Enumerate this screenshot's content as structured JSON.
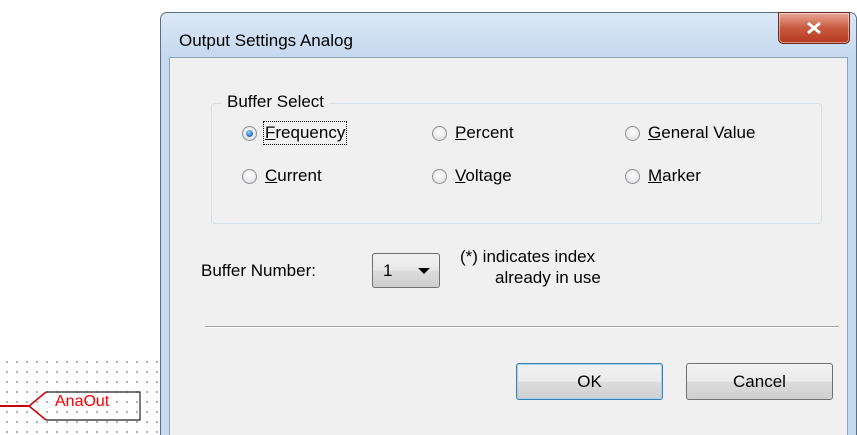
{
  "background_canvas": {
    "component_label": "AnaOut",
    "accent_color": "#ff0000"
  },
  "dialog": {
    "title": "Output Settings Analog",
    "close_icon": "close-x-icon",
    "buffer_select": {
      "legend": "Buffer Select",
      "options": [
        {
          "label": "Frequency",
          "mnemonic": "F",
          "rest": "requency",
          "checked": true
        },
        {
          "label": "Percent",
          "mnemonic": "P",
          "rest": "ercent",
          "checked": false
        },
        {
          "label": "General Value",
          "mnemonic": "G",
          "rest": "eneral Value",
          "checked": false
        },
        {
          "label": "Current",
          "mnemonic": "C",
          "rest": "urrent",
          "checked": false
        },
        {
          "label": "Voltage",
          "mnemonic": "V",
          "rest": "oltage",
          "checked": false
        },
        {
          "label": "Marker",
          "mnemonic": "M",
          "rest": "arker",
          "checked": false
        }
      ]
    },
    "buffer_number": {
      "label": "Buffer Number:",
      "value": "1"
    },
    "hint": {
      "line1": "(*) indicates index",
      "line2": "already in use"
    },
    "ok_label": "OK",
    "cancel_label": "Cancel"
  }
}
